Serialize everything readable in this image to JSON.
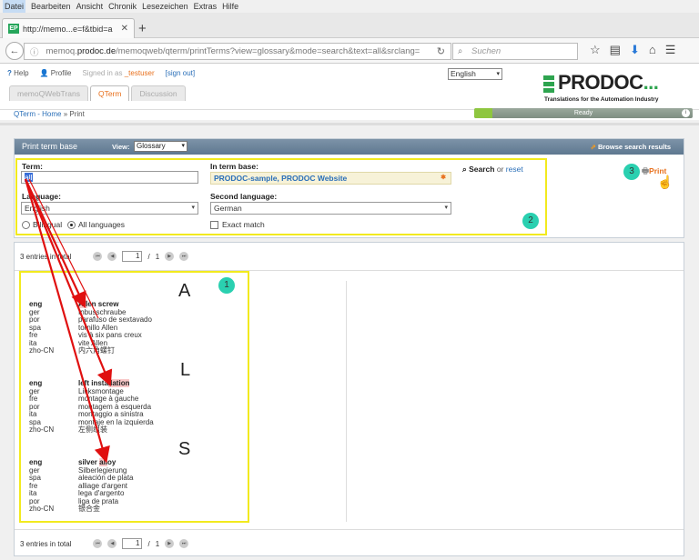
{
  "browser": {
    "menu": [
      "Datei",
      "Bearbeiten",
      "Ansicht",
      "Chronik",
      "Lesezeichen",
      "Extras",
      "Hilfe"
    ],
    "tab_title": "http://memo...e=f&tbid=a",
    "tab_favicon": "EP",
    "url_prefix": "memoq.",
    "url_domain": "prodoc.de",
    "url_rest": "/memoqweb/qterm/printTerms?view=glossary&mode=search&text=all&srclang=",
    "search_placeholder": "Suchen"
  },
  "header": {
    "help": "Help",
    "profile": "Profile",
    "signed_in_as": "Signed in as",
    "user": "_testuser",
    "sign_out": "[sign out]",
    "language": "English",
    "logo_text": "PRODOC",
    "logo_dots": "...",
    "logo_tagline": "Translations for the Automation Industry",
    "tabs": [
      "memoQWebTrans",
      "QTerm",
      "Discussion"
    ],
    "active_tab": "QTerm",
    "breadcrumb_home": "QTerm - Home",
    "breadcrumb_sep": "»",
    "breadcrumb_current": "Print",
    "status": "Ready"
  },
  "panel": {
    "title": "Print term base",
    "view_label": "View:",
    "view_value": "Glossary",
    "browse_label": "Browse search results",
    "term_label": "Term:",
    "term_value": "all",
    "termbase_label": "In term base:",
    "termbase_value": "PRODOC-sample, PRODOC Website",
    "search_label": "Search",
    "or_label": "or",
    "reset_label": "reset",
    "language_label": "Language:",
    "language_value": "English",
    "second_language_label": "Second language:",
    "second_language_value": "German",
    "bilingual_label": "Bilingual",
    "all_languages_label": "All languages",
    "exact_match_label": "Exact match",
    "print_label": "Print"
  },
  "callouts": [
    "1",
    "2",
    "3"
  ],
  "results": {
    "count_text": "3 entries in total",
    "page_value": "1",
    "page_sep": "/",
    "page_total": "1",
    "letters": [
      "A",
      "L",
      "S"
    ],
    "entries": [
      {
        "main_lang": "eng",
        "main_pre": "",
        "main_mark": "All",
        "main_post": "en screw",
        "rows": [
          {
            "lang": "ger",
            "term": "Inbusschraube"
          },
          {
            "lang": "por",
            "term": "parafuso de sextavado"
          },
          {
            "lang": "spa",
            "term": "tornillo Allen"
          },
          {
            "lang": "fre",
            "term": "vis à six pans creux"
          },
          {
            "lang": "ita",
            "term": "vite Allen"
          },
          {
            "lang": "zho-CN",
            "term": "内六角螺钉"
          }
        ]
      },
      {
        "main_lang": "eng",
        "main_pre": "left insta",
        "main_mark": "llation",
        "main_post": "",
        "rows": [
          {
            "lang": "ger",
            "term": "Linksmontage"
          },
          {
            "lang": "fre",
            "term": "montage à gauche"
          },
          {
            "lang": "por",
            "term": "montagem à esquerda"
          },
          {
            "lang": "ita",
            "term": "montaggio a sinistra"
          },
          {
            "lang": "spa",
            "term": "montaje en la izquierda"
          },
          {
            "lang": "zho-CN",
            "term": "左侧组装"
          }
        ]
      },
      {
        "main_lang": "eng",
        "main_pre": "silver ",
        "main_mark": "all",
        "main_post": "oy",
        "rows": [
          {
            "lang": "ger",
            "term": "Silberlegierung"
          },
          {
            "lang": "spa",
            "term": "aleación de plata"
          },
          {
            "lang": "fre",
            "term": "alliage d'argent"
          },
          {
            "lang": "ita",
            "term": "lega d'argento"
          },
          {
            "lang": "por",
            "term": "liga de prata"
          },
          {
            "lang": "zho-CN",
            "term": "银合金"
          }
        ]
      }
    ]
  },
  "colors": {
    "accent_orange": "#e8701d",
    "callout_yellow": "#f2ea1e",
    "callout_teal": "#2ad0b0",
    "arrow_red": "#e01010"
  }
}
